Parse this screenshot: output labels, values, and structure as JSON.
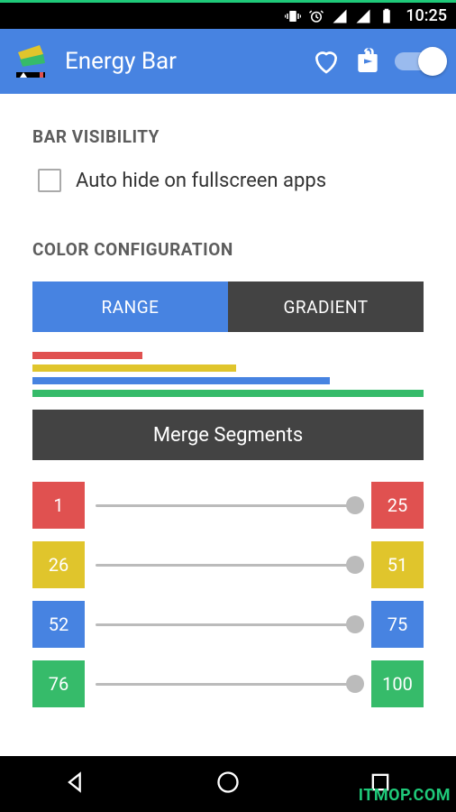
{
  "statusbar": {
    "time": "10:25"
  },
  "appbar": {
    "title": "Energy Bar",
    "toggle_on": true
  },
  "sections": {
    "visibility": {
      "header": "BAR VISIBILITY",
      "checkbox_label": "Auto hide on fullscreen apps"
    },
    "color_config": {
      "header": "COLOR CONFIGURATION",
      "tab_range": "RANGE",
      "tab_gradient": "GRADIENT",
      "merge_button": "Merge Segments",
      "segments": [
        {
          "start": "1",
          "end": "25",
          "color": "red",
          "start_class": "c-red",
          "end_class": "c-red"
        },
        {
          "start": "26",
          "end": "51",
          "color": "yellow",
          "start_class": "c-yellow",
          "end_class": "c-yellow"
        },
        {
          "start": "52",
          "end": "75",
          "color": "blue",
          "start_class": "c-blue",
          "end_class": "c-blue"
        },
        {
          "start": "76",
          "end": "100",
          "color": "green",
          "start_class": "c-green",
          "end_class": "c-green"
        }
      ]
    }
  },
  "watermark": "ITMOP.COM",
  "colors": {
    "accent_blue": "#4783e1",
    "red": "#e05150",
    "yellow": "#e0c52c",
    "green": "#36bb6a",
    "dark": "#434343"
  }
}
